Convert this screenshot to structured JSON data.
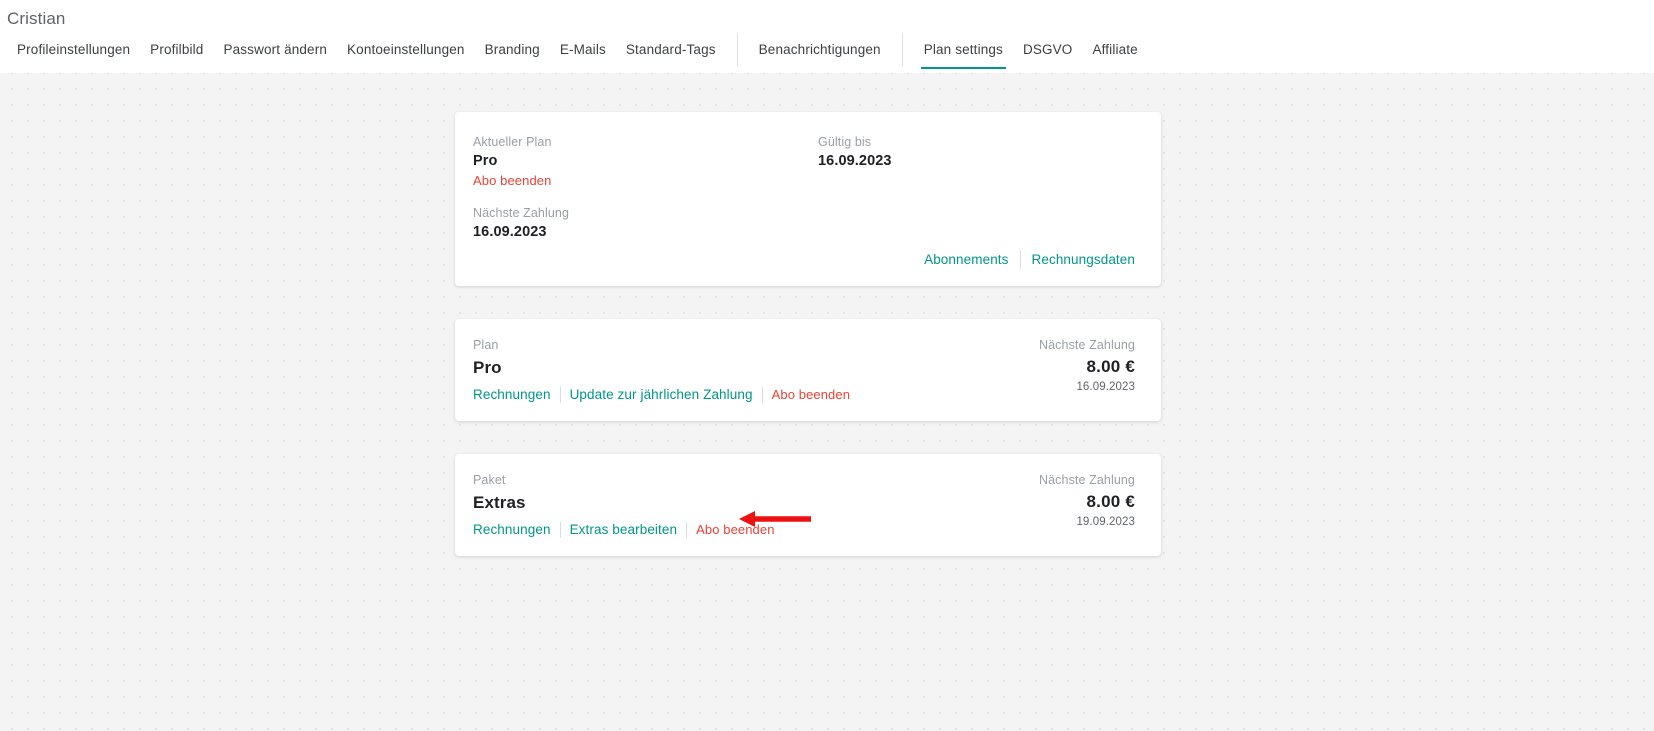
{
  "theme": {
    "accent": "#009688",
    "danger": "#ea4335",
    "page_bg": "#f4f4f4",
    "card_bg": "#ffffff",
    "muted_text": "#9aa0a6"
  },
  "header": {
    "title": "Cristian",
    "tabs": [
      {
        "label": "Profileinstellungen",
        "active": false
      },
      {
        "label": "Profilbild",
        "active": false
      },
      {
        "label": "Passwort ändern",
        "active": false
      },
      {
        "label": "Kontoeinstellungen",
        "active": false
      },
      {
        "label": "Branding",
        "active": false
      },
      {
        "label": "E-Mails",
        "active": false
      },
      {
        "label": "Standard-Tags",
        "active": false
      },
      {
        "label": "Benachrichtigungen",
        "active": false
      },
      {
        "label": "Plan settings",
        "active": true
      },
      {
        "label": "DSGVO",
        "active": false
      },
      {
        "label": "Affiliate",
        "active": false
      }
    ]
  },
  "plan_overview": {
    "current_plan_label": "Aktueller Plan",
    "current_plan_value": "Pro",
    "cancel_link": "Abo beenden",
    "next_payment_label": "Nächste Zahlung",
    "next_payment_value": "16.09.2023",
    "valid_until_label": "Gültig bis",
    "valid_until_value": "16.09.2023",
    "footer_links": {
      "subscriptions": "Abonnements",
      "billing_data": "Rechnungsdaten"
    }
  },
  "subscriptions": [
    {
      "type_label": "Plan",
      "name": "Pro",
      "actions": {
        "invoices": "Rechnungen",
        "upgrade": "Update zur jährlichen Zahlung",
        "cancel": "Abo beenden"
      },
      "next_payment_label": "Nächste Zahlung",
      "amount": "8.00 €",
      "date": "16.09.2023"
    },
    {
      "type_label": "Paket",
      "name": "Extras",
      "actions": {
        "invoices": "Rechnungen",
        "edit": "Extras bearbeiten",
        "cancel": "Abo beenden"
      },
      "next_payment_label": "Nächste Zahlung",
      "amount": "8.00 €",
      "date": "19.09.2023"
    }
  ],
  "annotation": {
    "icon": "left-arrow-annotation",
    "color": "#ee1111",
    "points_at": "Abo beenden"
  }
}
